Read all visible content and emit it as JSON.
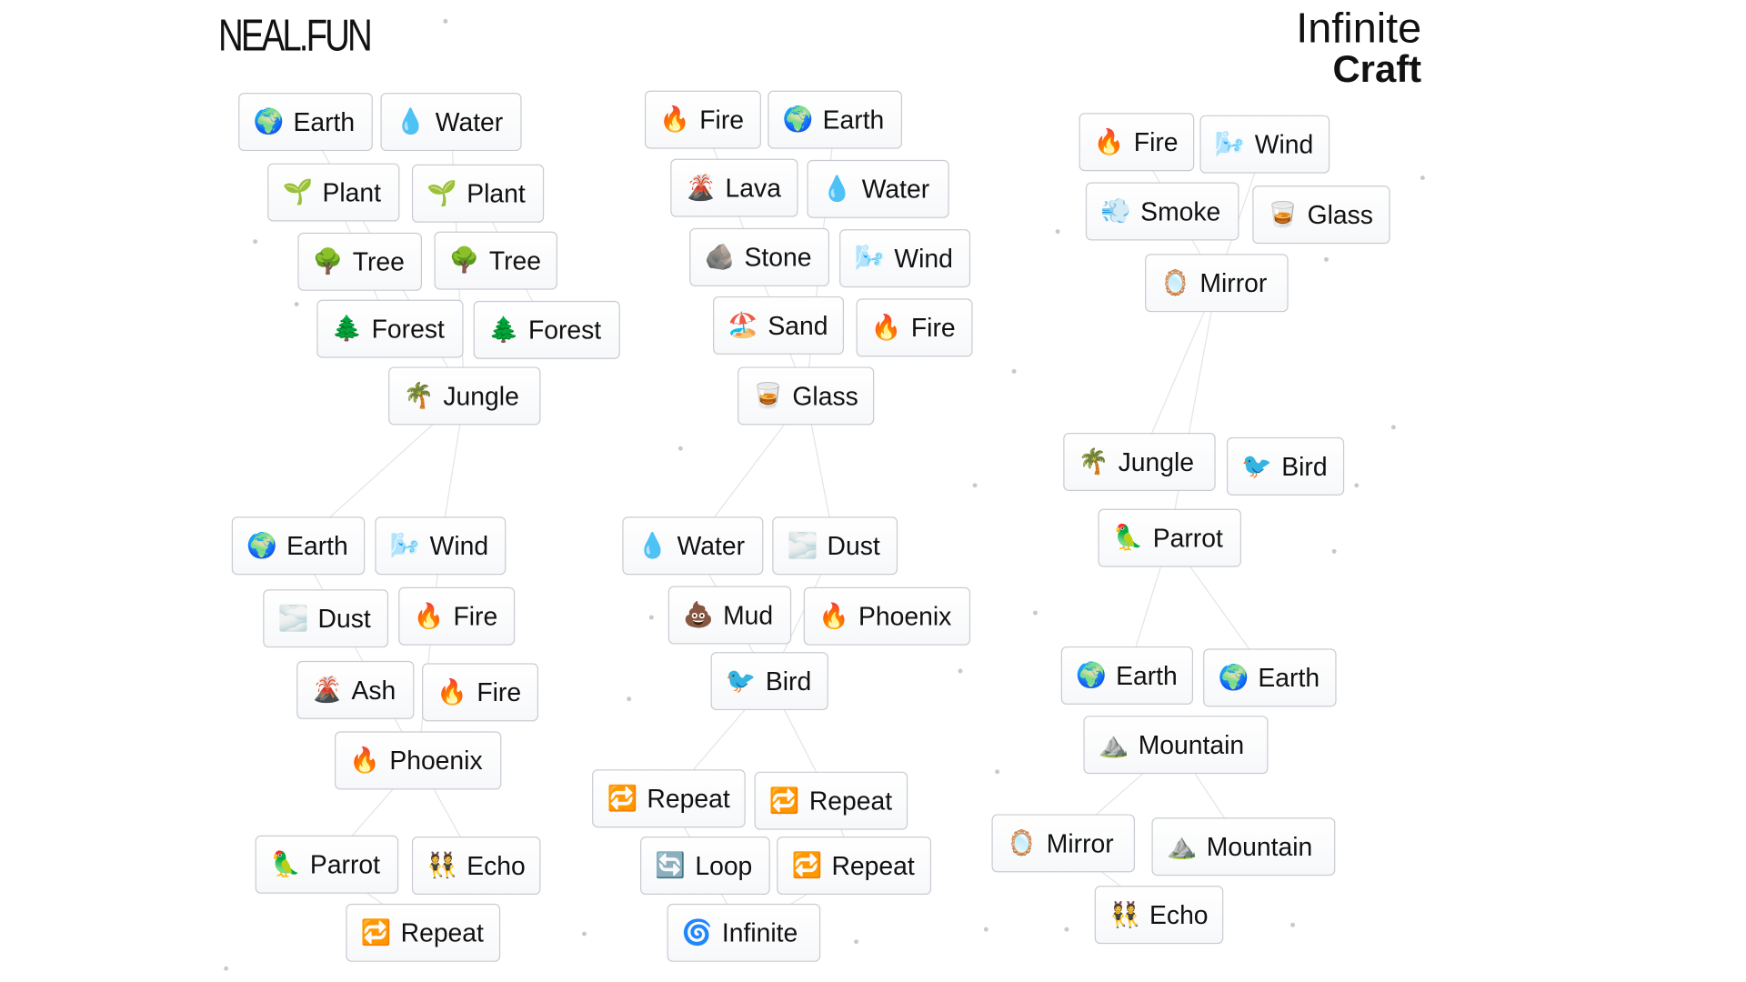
{
  "header": {
    "logo": "NEAL.FUN",
    "title_line1": "Infinite",
    "title_line2": "Craft"
  },
  "items": [
    {
      "label": "Earth",
      "icon": "🌍"
    },
    {
      "label": "Water",
      "icon": "💧"
    },
    {
      "label": "Plant",
      "icon": "🌱"
    },
    {
      "label": "Plant",
      "icon": "🌱"
    },
    {
      "label": "Tree",
      "icon": "🌳"
    },
    {
      "label": "Tree",
      "icon": "🌳"
    },
    {
      "label": "Forest",
      "icon": "🌲"
    },
    {
      "label": "Forest",
      "icon": "🌲"
    },
    {
      "label": "Jungle",
      "icon": "🌴"
    },
    {
      "label": "Fire",
      "icon": "🔥"
    },
    {
      "label": "Earth",
      "icon": "🌍"
    },
    {
      "label": "Lava",
      "icon": "🌋"
    },
    {
      "label": "Water",
      "icon": "💧"
    },
    {
      "label": "Stone",
      "icon": "🪨"
    },
    {
      "label": "Wind",
      "icon": "🌬️"
    },
    {
      "label": "Sand",
      "icon": "🏖️"
    },
    {
      "label": "Fire",
      "icon": "🔥"
    },
    {
      "label": "Glass",
      "icon": "🥃"
    },
    {
      "label": "Fire",
      "icon": "🔥"
    },
    {
      "label": "Wind",
      "icon": "🌬️"
    },
    {
      "label": "Smoke",
      "icon": "💨"
    },
    {
      "label": "Glass",
      "icon": "🥃"
    },
    {
      "label": "Mirror",
      "icon": "🪞"
    },
    {
      "label": "Jungle",
      "icon": "🌴"
    },
    {
      "label": "Bird",
      "icon": "🐦"
    },
    {
      "label": "Parrot",
      "icon": "🦜"
    },
    {
      "label": "Earth",
      "icon": "🌍"
    },
    {
      "label": "Wind",
      "icon": "🌬️"
    },
    {
      "label": "Water",
      "icon": "💧"
    },
    {
      "label": "Dust",
      "icon": "🌫️"
    },
    {
      "label": "Dust",
      "icon": "🌫️"
    },
    {
      "label": "Fire",
      "icon": "🔥"
    },
    {
      "label": "Mud",
      "icon": "💩"
    },
    {
      "label": "Phoenix",
      "icon": "🔥"
    },
    {
      "label": "Ash",
      "icon": "🌋"
    },
    {
      "label": "Fire",
      "icon": "🔥"
    },
    {
      "label": "Bird",
      "icon": "🐦"
    },
    {
      "label": "Phoenix",
      "icon": "🔥"
    },
    {
      "label": "Earth",
      "icon": "🌍"
    },
    {
      "label": "Earth",
      "icon": "🌍"
    },
    {
      "label": "Mountain",
      "icon": "⛰️"
    },
    {
      "label": "Repeat",
      "icon": "🔁"
    },
    {
      "label": "Repeat",
      "icon": "🔁"
    },
    {
      "label": "Mirror",
      "icon": "🪞"
    },
    {
      "label": "Mountain",
      "icon": "⛰️"
    },
    {
      "label": "Parrot",
      "icon": "🦜"
    },
    {
      "label": "Echo",
      "icon": "👯"
    },
    {
      "label": "Loop",
      "icon": "🔄"
    },
    {
      "label": "Repeat",
      "icon": "🔁"
    },
    {
      "label": "Echo",
      "icon": "👯"
    },
    {
      "label": "Repeat",
      "icon": "🔁"
    },
    {
      "label": "Infinite",
      "icon": "🌀"
    }
  ]
}
